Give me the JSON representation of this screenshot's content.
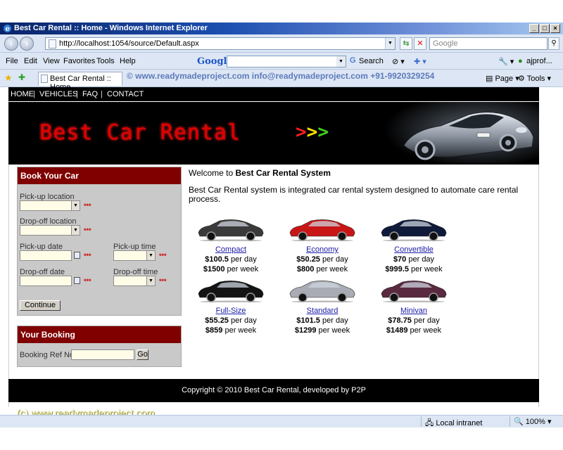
{
  "window": {
    "title": "Best Car Rental :: Home - Windows Internet Explorer"
  },
  "address_bar": {
    "url": "http://localhost:1054/source/Default.aspx",
    "search_placeholder": "Google"
  },
  "menu": {
    "items": [
      "File",
      "Edit",
      "View",
      "Favorites",
      "Tools",
      "Help"
    ],
    "google_label": "Google",
    "search_label": "Search",
    "user_label": "ajprof..."
  },
  "tabs": {
    "active": "Best Car Rental :: Home",
    "page_label": "Page",
    "tools_label": "Tools"
  },
  "watermark": "© www.readymadeproject.com info@readymadeproject.com +91-9920329254",
  "site": {
    "nav": [
      "HOME",
      "VEHICLES",
      "FAQ",
      "CONTACT"
    ],
    "brand": "Best Car Rental",
    "arrows": [
      ">",
      ">",
      ">"
    ],
    "arrow_colors": [
      "#ff2020",
      "#ffe000",
      "#40d020"
    ]
  },
  "book_panel": {
    "title": "Book Your Car",
    "pickup_location": "Pick-up location",
    "dropoff_location": "Drop-off location",
    "pickup_date": "Pick-up date",
    "pickup_time": "Pick-up time",
    "dropoff_date": "Drop-off date",
    "dropoff_time": "Drop-off time",
    "required": "***",
    "continue": "Continue"
  },
  "booking_panel": {
    "title": "Your Booking",
    "ref_label": "Booking Ref No",
    "go": "Go"
  },
  "welcome": {
    "prefix": "Welcome to",
    "name": "Best Car Rental System"
  },
  "intro": "Best Car Rental system is integrated car rental system designed to automate care rental process.",
  "cars": [
    {
      "name": "Compact",
      "day_price": "$100.5",
      "week_price": "$1500",
      "color": "#3a3a3a"
    },
    {
      "name": "Economy",
      "day_price": "$50.25",
      "week_price": "$800",
      "color": "#c81616"
    },
    {
      "name": "Convertible",
      "day_price": "$70",
      "week_price": "$999.5",
      "color": "#0f1a3a"
    },
    {
      "name": "Full-Size",
      "day_price": "$55.25",
      "week_price": "$859",
      "color": "#141414"
    },
    {
      "name": "Standard",
      "day_price": "$101.5",
      "week_price": "$1299",
      "color": "#a9acb4"
    },
    {
      "name": "Minivan",
      "day_price": "$78.75",
      "week_price": "$1489",
      "color": "#5a2a40"
    }
  ],
  "price_units": {
    "day": "per day",
    "week": "per week"
  },
  "footer": "Copyright © 2010 Best Car Rental, developed by P2P",
  "copyright_watermark": "(c) www.readymadeproject.com",
  "status": {
    "zone": "Local intranet",
    "zoom": "100%"
  }
}
